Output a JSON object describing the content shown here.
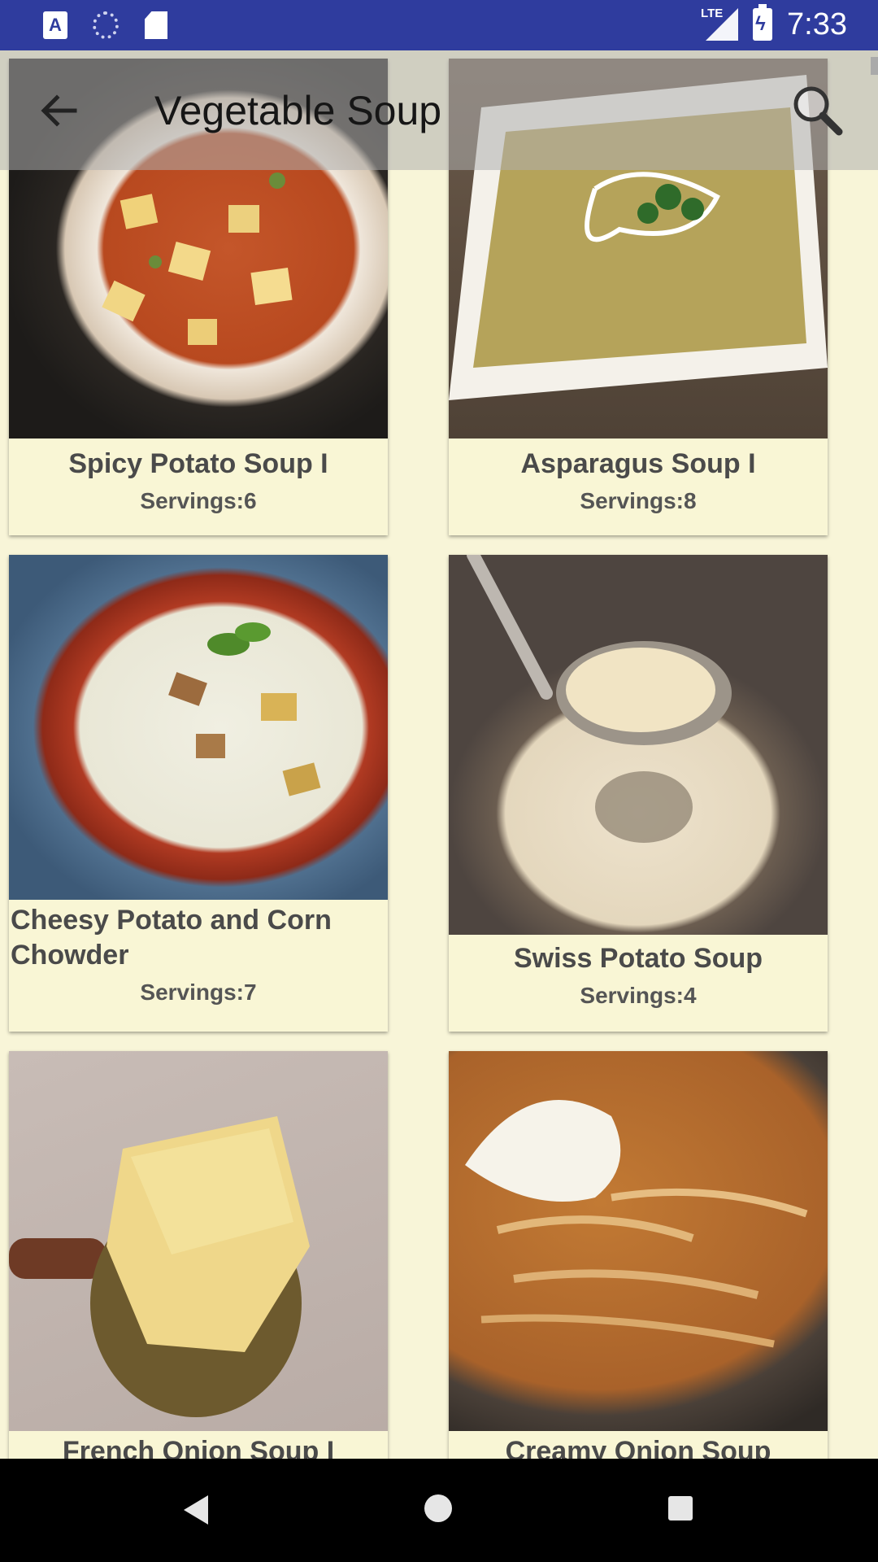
{
  "status_bar": {
    "time": "7:33",
    "network": "LTE",
    "icons": [
      "accessibility-a-icon",
      "sync-icon",
      "sd-card-icon",
      "lte-signal-icon",
      "battery-charging-icon"
    ]
  },
  "app_bar": {
    "title": "Vegetable Soup",
    "back_icon": "arrow-back-icon",
    "search_icon": "search-icon"
  },
  "recipes": [
    {
      "title": "Spicy Potato Soup I",
      "servings": "Servings:6"
    },
    {
      "title": "Asparagus Soup I",
      "servings": "Servings:8"
    },
    {
      "title": "Cheesy Potato and Corn Chowder",
      "servings": "Servings:7"
    },
    {
      "title": "Swiss Potato Soup",
      "servings": "Servings:4"
    },
    {
      "title": "French Onion Soup I",
      "servings": ""
    },
    {
      "title": "Creamy Onion Soup",
      "servings": ""
    }
  ],
  "nav_bar": {
    "icons": [
      "back-triangle-icon",
      "home-circle-icon",
      "recents-square-icon"
    ]
  }
}
